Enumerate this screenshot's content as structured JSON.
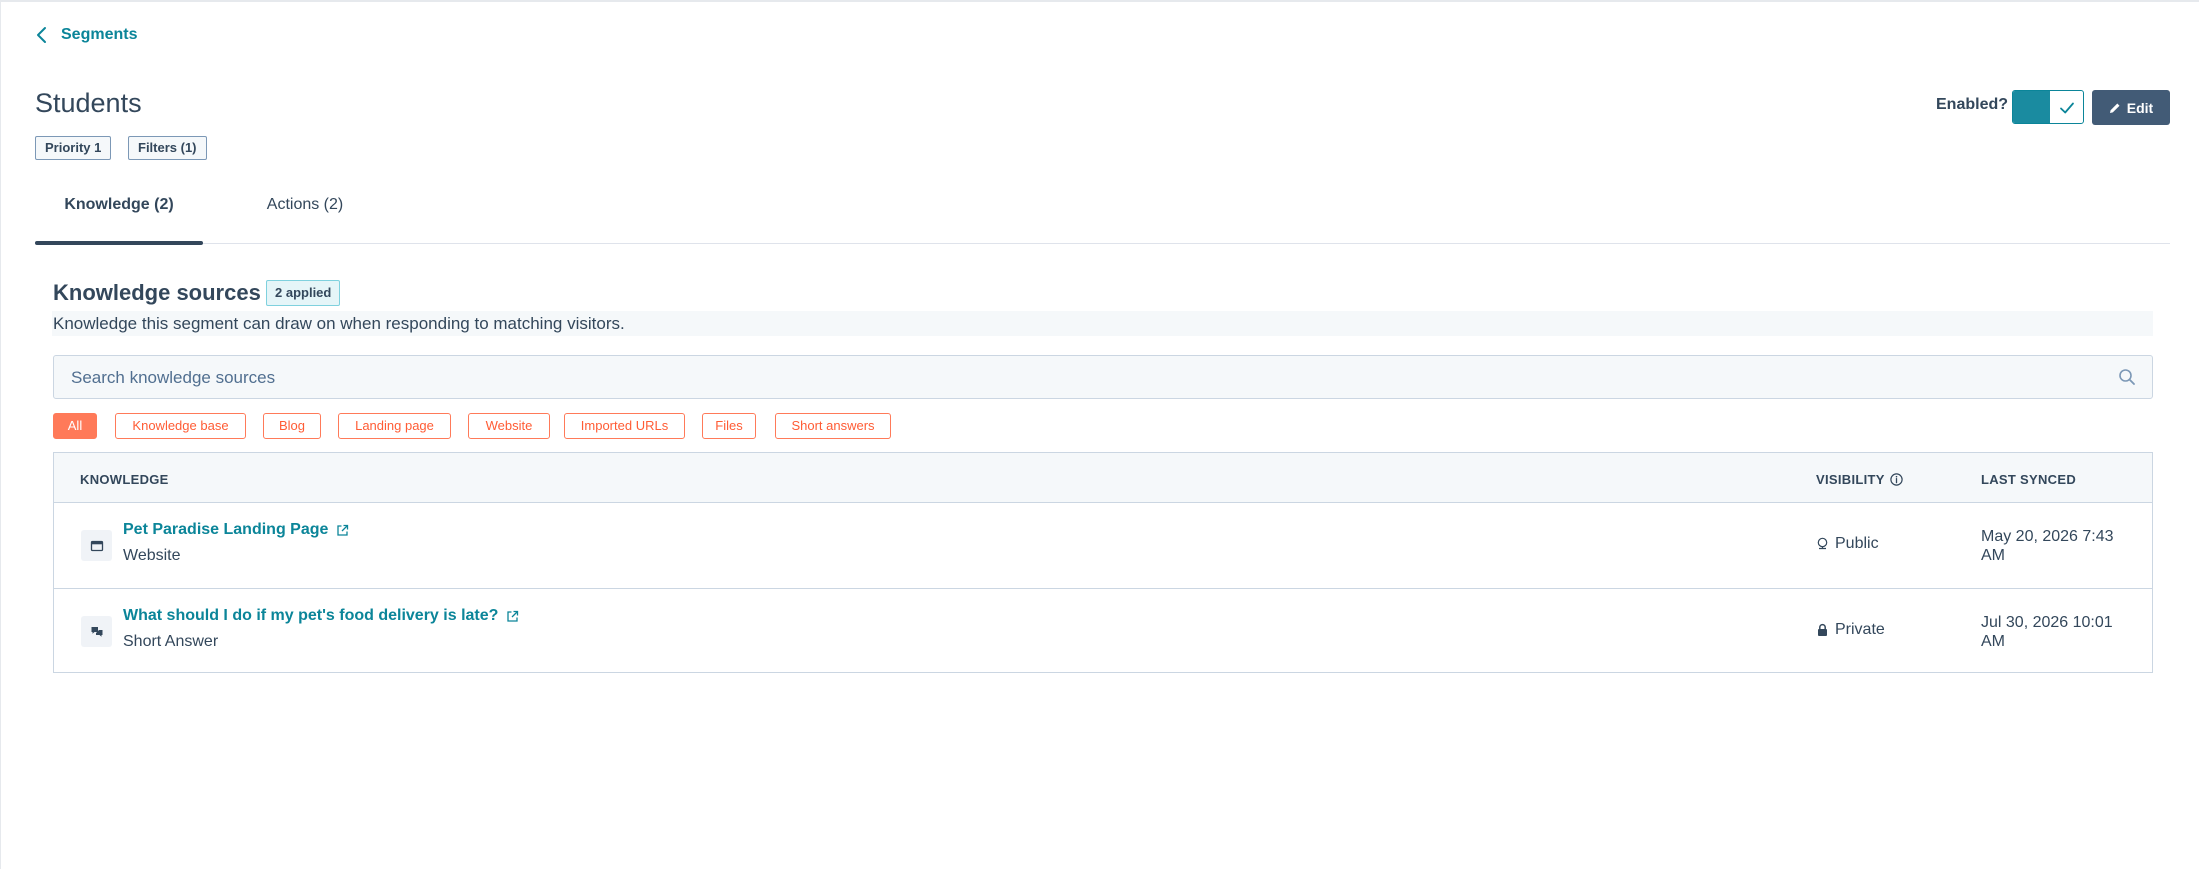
{
  "breadcrumb": {
    "label": "Segments"
  },
  "page": {
    "title": "Students"
  },
  "tags": [
    {
      "label": "Priority 1"
    },
    {
      "label": "Filters (1)"
    }
  ],
  "header": {
    "enabled_label": "Enabled?",
    "enabled": true,
    "edit_label": "Edit"
  },
  "tabs": [
    {
      "label": "Knowledge (2)",
      "active": true
    },
    {
      "label": "Actions (2)",
      "active": false
    }
  ],
  "knowledge": {
    "title": "Knowledge sources",
    "badge": "2 applied",
    "description": "Knowledge this segment can draw on when responding to matching visitors.",
    "search_placeholder": "Search knowledge sources",
    "filters": [
      {
        "label": "All",
        "active": true
      },
      {
        "label": "Knowledge base",
        "active": false
      },
      {
        "label": "Blog",
        "active": false
      },
      {
        "label": "Landing page",
        "active": false
      },
      {
        "label": "Website",
        "active": false
      },
      {
        "label": "Imported URLs",
        "active": false
      },
      {
        "label": "Files",
        "active": false
      },
      {
        "label": "Short answers",
        "active": false
      }
    ],
    "table": {
      "columns": {
        "knowledge": "KNOWLEDGE",
        "visibility": "VISIBILITY",
        "last_synced": "LAST SYNCED"
      },
      "rows": [
        {
          "icon": "browser-window-icon",
          "title": "Pet Paradise Landing Page",
          "type": "Website",
          "visibility_icon": "globe-icon",
          "visibility": "Public",
          "last_synced": "May 20, 2026 7:43 AM"
        },
        {
          "icon": "chat-bubbles-icon",
          "title": "What should I do if my pet's food delivery is late?",
          "type": "Short Answer",
          "visibility_icon": "lock-icon",
          "visibility": "Private",
          "last_synced": "Jul 30, 2026 10:01 AM"
        }
      ]
    }
  },
  "colors": {
    "accent": "#0b8599",
    "toggle": "#1a8ba0",
    "edit_button": "#425b76",
    "chip": "#ff7a59",
    "text": "#33475b"
  }
}
